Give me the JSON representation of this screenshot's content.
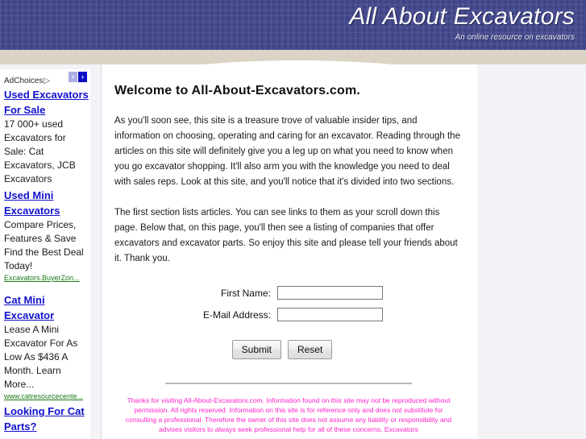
{
  "banner": {
    "title": "All About Excavators",
    "tagline": "An online resource on excavators"
  },
  "sidebar": {
    "adchoices_label": "AdChoices",
    "adchoices_icon": "adchoices-triangle-icon",
    "prev_arrow": "‹",
    "next_arrow": "›",
    "ads": [
      {
        "title": "Used Excavators For Sale",
        "description": "17 000+ used Excavators for Sale: Cat Excavators, JCB Excavators",
        "url": ""
      },
      {
        "title": "Used Mini Excavators",
        "description": "Compare Prices, Features & Save Find the Best Deal Today!",
        "url": "Excavators.BuyerZon..."
      },
      {
        "title": "Cat Mini Excavator",
        "description": "Lease A Mini Excavator For As Low As $436 A Month. Learn More...",
        "url": "www.catresourcecente..."
      },
      {
        "title": "Looking For Cat Parts?",
        "description": "",
        "url": ""
      }
    ]
  },
  "main": {
    "heading": "Welcome to All-About-Excavators.com.",
    "paragraphs": [
      "As you'll soon see, this site is a treasure trove of valuable insider tips, and information on choosing, operating and caring for an excavator.  Reading through the articles on this site will definitely give you a leg up on what you need to know when you go excavator shopping.  It'll also arm you with the knowledge you need to deal with sales reps.  Look at this site, and you'll notice that it's divided into two sections.",
      "The first section lists articles.  You can see links to them as your scroll down this page.  Below that, on this page, you'll then see a listing of companies that offer excavators and excavator parts.  So enjoy this site and please tell your friends about it.  Thank you."
    ],
    "form": {
      "first_name_label": "First Name:",
      "first_name_value": "",
      "first_name_placeholder": "",
      "email_label": "E-Mail Address:",
      "email_value": "",
      "email_placeholder": "",
      "submit_label": "Submit",
      "reset_label": "Reset"
    },
    "footer_text": "Thanks for visiting All-About-Excavators.com. Information found on this site may not be reproduced without permission.  All rights reserved. Information on this site is for reference only and does not substitute for consulting a professional.  Therefore the owner of this site does not assume any liability or responsibility and advises visitors to always seek professional help for all of these concerns. Excavators"
  },
  "colors": {
    "banner_blue": "#454a8e",
    "beige": "#dbd3c3",
    "page_bg": "#f3f2f7",
    "link_blue": "#1111cc",
    "url_green": "#1a7a1a",
    "footer_pink": "#ff22cc"
  }
}
